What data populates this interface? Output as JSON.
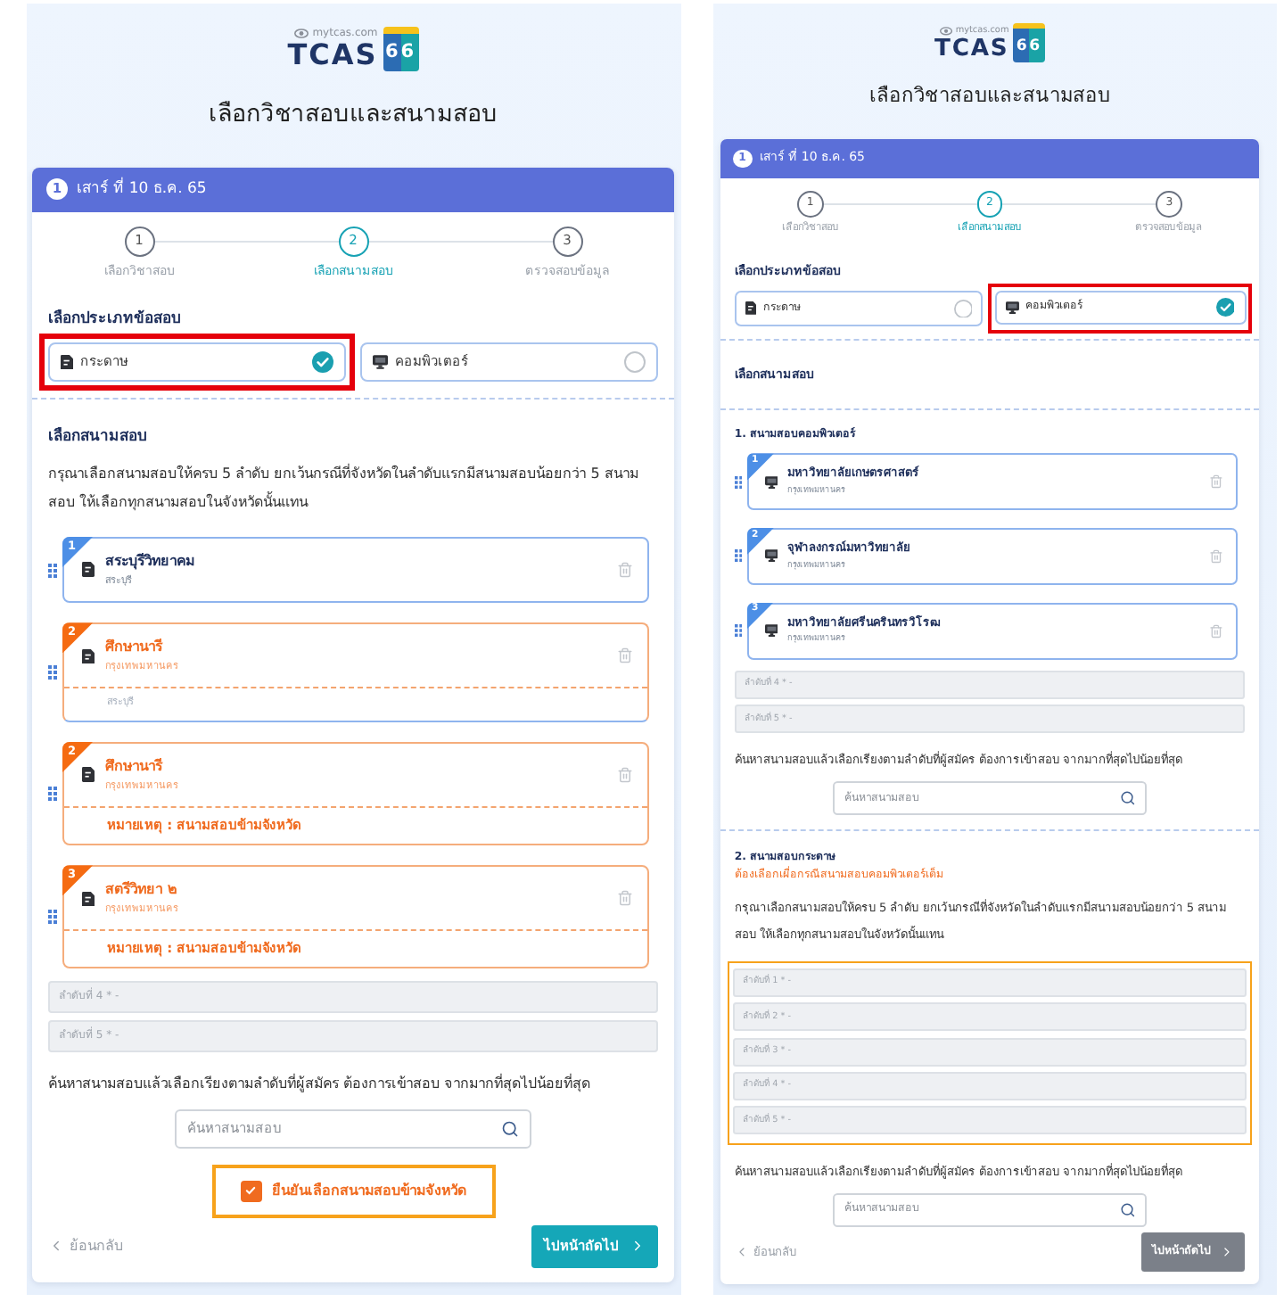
{
  "panels": [
    {
      "logo": {
        "site": "mytcas.com",
        "name": "TCAS",
        "year": "66"
      },
      "title": "เลือกวิชาสอบและสนามสอบ",
      "header": {
        "badge": "1",
        "date": "เสาร์ ที่ 10 ธ.ค. 65"
      },
      "steps": [
        {
          "number": "1",
          "label": "เลือกวิชาสอบ",
          "selected": false
        },
        {
          "number": "2",
          "label": "เลือกสนามสอบ",
          "selected": true
        },
        {
          "number": "3",
          "label": "ตรวจสอบข้อมูล",
          "selected": false
        }
      ],
      "type_heading": "เลือกประเภทข้อสอบ",
      "options": [
        {
          "kind": "paper",
          "label": "กระดาษ",
          "selected": true,
          "highlighted": true
        },
        {
          "kind": "computer",
          "label": "คอมพิวเตอร์",
          "selected": false,
          "highlighted": false
        }
      ],
      "venue_heading": "เลือกสนามสอบ",
      "groups": [
        {
          "kind": "paper",
          "intro": "กรุณาเลือกสนามสอบให้ครบ 5 ลำดับ ยกเว้นกรณีที่จังหวัดในลำดับแรกมีสนามสอบน้อยกว่า 5 สนามสอบ ให้เลือกทุกสนามสอบในจังหวัดนั้นแทน",
          "venues": [
            {
              "kind": "home",
              "number": "1",
              "name": "สระบุรีวิทยาคม",
              "province": "สระบุรี"
            },
            {
              "kind": "dragged",
              "number": "2",
              "name": "ศึกษานารี",
              "province": "กรุงเทพมหานคร",
              "under": "สระบุรี"
            },
            {
              "kind": "cross",
              "number": "2",
              "name": "ศึกษานารี",
              "province": "กรุงเทพมหานคร",
              "note": "หมายเหตุ : สนามสอบข้ามจังหวัด"
            },
            {
              "kind": "cross",
              "number": "3",
              "name": "สตรีวิทยา ๒",
              "province": "กรุงเทพมหานคร",
              "note": "หมายเหตุ : สนามสอบข้ามจังหวัด"
            }
          ],
          "slots": [
            "ลำดับที่ 4 * -",
            "ลำดับที่ 5 * -"
          ],
          "slots_highlighted": false,
          "instruction": "ค้นหาสนามสอบแล้วเลือกเรียงตามลำดับที่ผู้สมัคร ต้องการเข้าสอบ จากมากที่สุดไปน้อยที่สุด",
          "search": {
            "placeholder": "ค้นหาสนามสอบ"
          }
        }
      ],
      "confirm": {
        "label": "ยืนยันเลือกสนามสอบข้ามจังหวัด",
        "checked": true,
        "highlighted": true
      },
      "back": "ย้อนกลับ",
      "next": {
        "label": "ไปหน้าถัดไป",
        "disabled": false
      }
    },
    {
      "logo": {
        "site": "mytcas.com",
        "name": "TCAS",
        "year": "66"
      },
      "title": "เลือกวิชาสอบและสนามสอบ",
      "header": {
        "badge": "1",
        "date": "เสาร์ ที่ 10 ธ.ค. 65"
      },
      "steps": [
        {
          "number": "1",
          "label": "เลือกวิชาสอบ",
          "selected": false
        },
        {
          "number": "2",
          "label": "เลือกสนามสอบ",
          "selected": true
        },
        {
          "number": "3",
          "label": "ตรวจสอบข้อมูล",
          "selected": false
        }
      ],
      "type_heading": "เลือกประเภทข้อสอบ",
      "options": [
        {
          "kind": "paper",
          "label": "กระดาษ",
          "selected": false,
          "highlighted": false
        },
        {
          "kind": "computer",
          "label": "คอมพิวเตอร์",
          "selected": true,
          "highlighted": true
        }
      ],
      "venue_heading": "เลือกสนามสอบ",
      "groups": [
        {
          "kind": "computer",
          "heading": "1. สนามสอบคอมพิวเตอร์",
          "venues": [
            {
              "kind": "home",
              "number": "1",
              "name": "มหาวิทยาลัยเกษตรศาสตร์",
              "province": "กรุงเทพมหานคร"
            },
            {
              "kind": "home",
              "number": "2",
              "name": "จุฬาลงกรณ์มหาวิทยาลัย",
              "province": "กรุงเทพมหานคร"
            },
            {
              "kind": "home",
              "number": "3",
              "name": "มหาวิทยาลัยศรีนครินทรวิโรฒ",
              "province": "กรุงเทพมหานคร"
            }
          ],
          "slots": [
            "ลำดับที่ 4 * -",
            "ลำดับที่ 5 * -"
          ],
          "slots_highlighted": false,
          "instruction": "ค้นหาสนามสอบแล้วเลือกเรียงตามลำดับที่ผู้สมัคร ต้องการเข้าสอบ จากมากที่สุดไปน้อยที่สุด",
          "search": {
            "placeholder": "ค้นหาสนามสอบ"
          }
        },
        {
          "heading": "2. สนามสอบกระดาษ",
          "note": "ต้องเลือกเผื่อกรณีสนามสอบคอมพิวเตอร์เต็ม",
          "intro": "กรุณาเลือกสนามสอบให้ครบ 5 ลำดับ ยกเว้นกรณีที่จังหวัดในลำดับแรกมีสนามสอบน้อยกว่า 5 สนามสอบ ให้เลือกทุกสนามสอบในจังหวัดนั้นแทน",
          "slots": [
            "ลำดับที่ 1 * -",
            "ลำดับที่ 2 * -",
            "ลำดับที่ 3 * -",
            "ลำดับที่ 4 * -",
            "ลำดับที่ 5 * -"
          ],
          "slots_highlighted": true,
          "instruction": "ค้นหาสนามสอบแล้วเลือกเรียงตามลำดับที่ผู้สมัคร ต้องการเข้าสอบ จากมากที่สุดไปน้อยที่สุด",
          "search": {
            "placeholder": "ค้นหาสนามสอบ"
          }
        }
      ],
      "back": "ย้อนกลับ",
      "next": {
        "label": "ไปหน้าถัดไป",
        "disabled": true
      }
    }
  ]
}
